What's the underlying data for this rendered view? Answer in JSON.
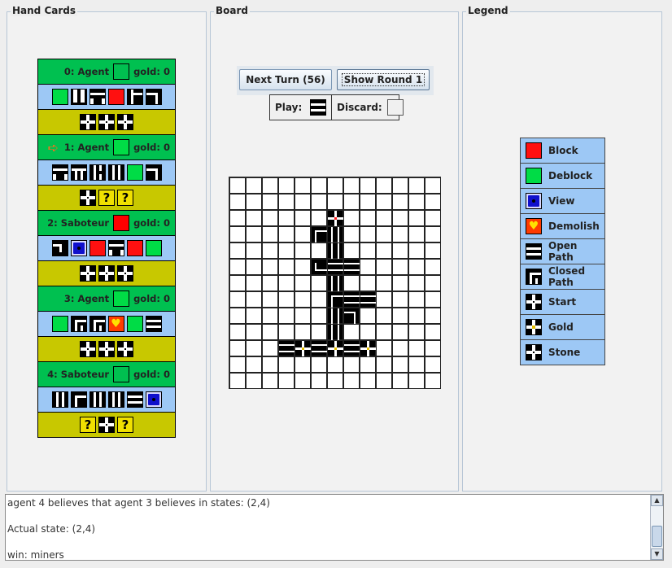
{
  "panels": {
    "hand_title": "Hand Cards",
    "board_title": "Board",
    "legend_title": "Legend"
  },
  "players": [
    {
      "label": "0: Agent",
      "gold": "gold: 0",
      "color": "green-dark",
      "current": false,
      "cards": [
        "green",
        "path-a",
        "path-b",
        "red",
        "path-c",
        "path-d"
      ],
      "stones": [
        "stone",
        "stone",
        "stone"
      ]
    },
    {
      "label": "1: Agent",
      "gold": "gold: 0",
      "color": "green",
      "current": true,
      "cards": [
        "path-b",
        "path-e",
        "path-f",
        "path-g",
        "green",
        "path-d"
      ],
      "stones": [
        "stone",
        "question",
        "question"
      ]
    },
    {
      "label": "2: Saboteur",
      "gold": "gold: 0",
      "color": "red",
      "current": false,
      "cards": [
        "path-h",
        "blue",
        "red",
        "path-b",
        "red",
        "green"
      ],
      "stones": [
        "stone",
        "stone",
        "stone"
      ]
    },
    {
      "label": "3: Agent",
      "gold": "gold: 0",
      "color": "green",
      "current": false,
      "cards": [
        "green",
        "path-i",
        "path-i",
        "demolish",
        "green",
        "path-j"
      ],
      "stones": [
        "stone",
        "stone",
        "stone"
      ]
    },
    {
      "label": "4: Saboteur",
      "gold": "gold: 0",
      "color": "green-dark",
      "current": false,
      "cards": [
        "path-g",
        "path-k",
        "path-g",
        "path-l",
        "path-j",
        "blue"
      ],
      "stones": [
        "question",
        "stone",
        "question"
      ]
    }
  ],
  "board": {
    "next_turn_label": "Next Turn (56)",
    "show_round_label": "Show Round 1",
    "play_label": "Play:",
    "discard_label": "Discard:"
  },
  "legend": [
    {
      "icon": "red",
      "label": "Block"
    },
    {
      "icon": "green",
      "label": "Deblock"
    },
    {
      "icon": "blue",
      "label": "View"
    },
    {
      "icon": "demolish",
      "label": "Demolish"
    },
    {
      "icon": "path-j",
      "label": "Open Path"
    },
    {
      "icon": "path-i",
      "label": "Closed Path"
    },
    {
      "icon": "stone",
      "label": "Start"
    },
    {
      "icon": "gold",
      "label": "Gold"
    },
    {
      "icon": "stone",
      "label": "Stone"
    }
  ],
  "log": [
    "agent 4 believes that agent 3 believes in states: (2,4)",
    "",
    "Actual state: (2,4)",
    "",
    "win: miners"
  ]
}
